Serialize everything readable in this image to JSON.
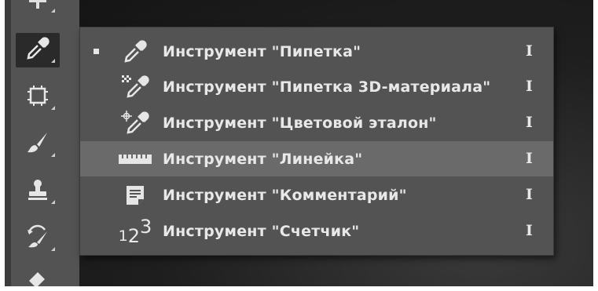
{
  "toolbar": {
    "tools": [
      {
        "name": "move-icon"
      },
      {
        "name": "eyedropper-icon",
        "active": true
      },
      {
        "name": "artboard-icon"
      },
      {
        "name": "brush-icon"
      },
      {
        "name": "stamp-icon"
      },
      {
        "name": "history-brush-icon"
      },
      {
        "name": "eraser-icon"
      }
    ]
  },
  "flyout": {
    "items": [
      {
        "label": "Инструмент \"Пипетка\"",
        "shortcut": "I",
        "icon": "eyedropper-icon",
        "selected": true
      },
      {
        "label": "Инструмент \"Пипетка 3D-материала\"",
        "shortcut": "I",
        "icon": "3d-material-eyedropper-icon"
      },
      {
        "label": "Инструмент \"Цветовой эталон\"",
        "shortcut": "I",
        "icon": "color-sampler-icon"
      },
      {
        "label": "Инструмент \"Линейка\"",
        "shortcut": "I",
        "icon": "ruler-icon",
        "hovered": true
      },
      {
        "label": "Инструмент \"Комментарий\"",
        "shortcut": "I",
        "icon": "note-icon"
      },
      {
        "label": "Инструмент \"Счетчик\"",
        "shortcut": "I",
        "icon": "count-icon",
        "glyph_a": "1",
        "glyph_b": "2",
        "glyph_c": "3"
      }
    ]
  },
  "colors": {
    "toolbar_bg": "#535353",
    "menu_bg": "#535353",
    "menu_hover": "#6a6a6a",
    "text": "#e8e8e8",
    "canvas": "#1b1b1b"
  }
}
